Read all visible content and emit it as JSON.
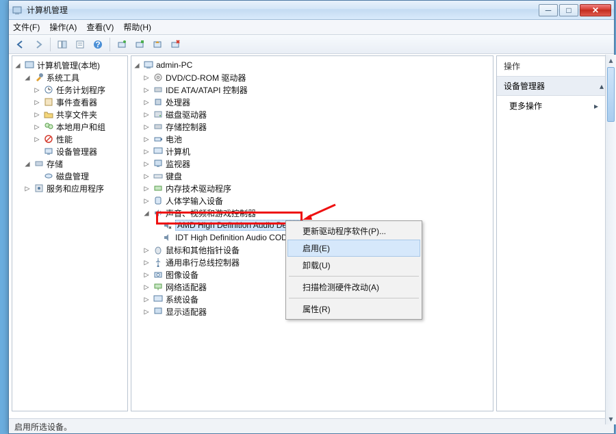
{
  "window": {
    "title": "计算机管理"
  },
  "menu": {
    "file": "文件(F)",
    "action": "操作(A)",
    "view": "查看(V)",
    "help": "帮助(H)"
  },
  "left_tree": {
    "root": "计算机管理(本地)",
    "system_tools": "系统工具",
    "task_scheduler": "任务计划程序",
    "event_viewer": "事件查看器",
    "shared_folders": "共享文件夹",
    "local_users": "本地用户和组",
    "performance": "性能",
    "device_manager": "设备管理器",
    "storage": "存储",
    "disk_mgmt": "磁盘管理",
    "services": "服务和应用程序"
  },
  "mid_tree": {
    "root": "admin-PC",
    "dvd": "DVD/CD-ROM 驱动器",
    "ide": "IDE ATA/ATAPI 控制器",
    "cpu": "处理器",
    "disk_drives": "磁盘驱动器",
    "storage_ctrl": "存储控制器",
    "battery": "电池",
    "computer": "计算机",
    "monitor": "监视器",
    "keyboard": "键盘",
    "memory_tech": "内存技术驱动程序",
    "hid": "人体学输入设备",
    "sound": "声音、视频和游戏控制器",
    "amd_audio": "AMD High Definition Audio Device",
    "idt_audio": "IDT High Definition Audio CODEC",
    "mouse": "鼠标和其他指针设备",
    "usb": "通用串行总线控制器",
    "imaging": "图像设备",
    "network": "网络适配器",
    "system_dev": "系统设备",
    "display": "显示适配器"
  },
  "context_menu": {
    "update_driver": "更新驱动程序软件(P)...",
    "enable": "启用(E)",
    "uninstall": "卸载(U)",
    "scan": "扫描检测硬件改动(A)",
    "properties": "属性(R)"
  },
  "actions": {
    "header": "操作",
    "section": "设备管理器",
    "more": "更多操作"
  },
  "status": "启用所选设备。"
}
